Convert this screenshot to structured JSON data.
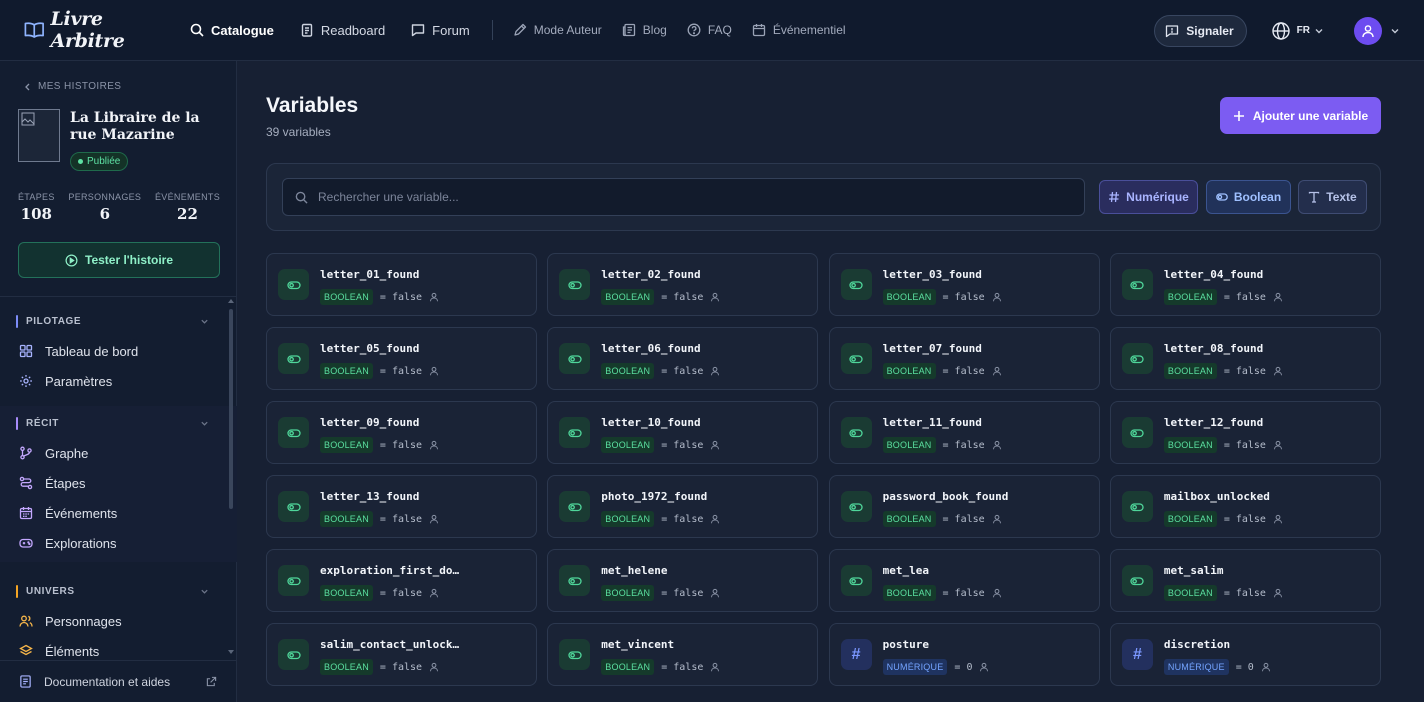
{
  "app": {
    "brand": "Livre Arbitre"
  },
  "nav": {
    "items": [
      {
        "label": "Catalogue",
        "icon": "search-icon",
        "active": true
      },
      {
        "label": "Readboard",
        "icon": "clipboard-icon",
        "active": false
      },
      {
        "label": "Forum",
        "icon": "message-icon",
        "active": false
      }
    ],
    "secondary": [
      {
        "label": "Mode Auteur",
        "icon": "pen-icon"
      },
      {
        "label": "Blog",
        "icon": "newspaper-icon"
      },
      {
        "label": "FAQ",
        "icon": "help-circle-icon"
      },
      {
        "label": "Événementiel",
        "icon": "calendar-icon"
      }
    ],
    "report_label": "Signaler",
    "language": "FR"
  },
  "sidebar": {
    "back_label": "MES HISTOIRES",
    "story_title": "La Libraire de la rue Mazarine",
    "status": "Publiée",
    "stats": [
      {
        "label": "ÉTAPES",
        "value": "108"
      },
      {
        "label": "PERSONNAGES",
        "value": "6"
      },
      {
        "label": "ÉVÉNEMENTS",
        "value": "22"
      }
    ],
    "test_label": "Tester l'histoire",
    "sections": [
      {
        "title": "PILOTAGE",
        "accent": "#7c8cf8",
        "items": [
          {
            "label": "Tableau de bord",
            "icon": "dashboard-icon"
          },
          {
            "label": "Paramètres",
            "icon": "gear-icon"
          }
        ]
      },
      {
        "title": "RÉCIT",
        "accent": "#a78bfa",
        "items": [
          {
            "label": "Graphe",
            "icon": "branch-icon"
          },
          {
            "label": "Étapes",
            "icon": "steps-icon"
          },
          {
            "label": "Événements",
            "icon": "calendar-icon"
          },
          {
            "label": "Explorations",
            "icon": "gamepad-icon"
          }
        ]
      },
      {
        "title": "UNIVERS",
        "accent": "#f5a524",
        "items": [
          {
            "label": "Personnages",
            "icon": "users-icon"
          },
          {
            "label": "Éléments",
            "icon": "layers-icon"
          }
        ]
      }
    ],
    "doc_label": "Documentation et aides"
  },
  "main": {
    "title": "Variables",
    "count_label": "39 variables",
    "add_label": "Ajouter une variable",
    "search_placeholder": "Rechercher une variable...",
    "filters": [
      {
        "label": "Numérique",
        "icon": "hash-icon"
      },
      {
        "label": "Boolean",
        "icon": "toggle-icon"
      },
      {
        "label": "Texte",
        "icon": "text-icon"
      }
    ],
    "variables": [
      {
        "name": "letter_01_found",
        "type": "BOOLEAN",
        "default": "= false"
      },
      {
        "name": "letter_02_found",
        "type": "BOOLEAN",
        "default": "= false"
      },
      {
        "name": "letter_03_found",
        "type": "BOOLEAN",
        "default": "= false"
      },
      {
        "name": "letter_04_found",
        "type": "BOOLEAN",
        "default": "= false"
      },
      {
        "name": "letter_05_found",
        "type": "BOOLEAN",
        "default": "= false"
      },
      {
        "name": "letter_06_found",
        "type": "BOOLEAN",
        "default": "= false"
      },
      {
        "name": "letter_07_found",
        "type": "BOOLEAN",
        "default": "= false"
      },
      {
        "name": "letter_08_found",
        "type": "BOOLEAN",
        "default": "= false"
      },
      {
        "name": "letter_09_found",
        "type": "BOOLEAN",
        "default": "= false"
      },
      {
        "name": "letter_10_found",
        "type": "BOOLEAN",
        "default": "= false"
      },
      {
        "name": "letter_11_found",
        "type": "BOOLEAN",
        "default": "= false"
      },
      {
        "name": "letter_12_found",
        "type": "BOOLEAN",
        "default": "= false"
      },
      {
        "name": "letter_13_found",
        "type": "BOOLEAN",
        "default": "= false"
      },
      {
        "name": "photo_1972_found",
        "type": "BOOLEAN",
        "default": "= false"
      },
      {
        "name": "password_book_found",
        "type": "BOOLEAN",
        "default": "= false"
      },
      {
        "name": "mailbox_unlocked",
        "type": "BOOLEAN",
        "default": "= false"
      },
      {
        "name": "exploration_first_do…",
        "type": "BOOLEAN",
        "default": "= false"
      },
      {
        "name": "met_helene",
        "type": "BOOLEAN",
        "default": "= false"
      },
      {
        "name": "met_lea",
        "type": "BOOLEAN",
        "default": "= false"
      },
      {
        "name": "met_salim",
        "type": "BOOLEAN",
        "default": "= false"
      },
      {
        "name": "salim_contact_unlock…",
        "type": "BOOLEAN",
        "default": "= false"
      },
      {
        "name": "met_vincent",
        "type": "BOOLEAN",
        "default": "= false"
      },
      {
        "name": "posture",
        "type": "NUMÉRIQUE",
        "default": "= 0"
      },
      {
        "name": "discretion",
        "type": "NUMÉRIQUE",
        "default": "= 0"
      }
    ]
  }
}
